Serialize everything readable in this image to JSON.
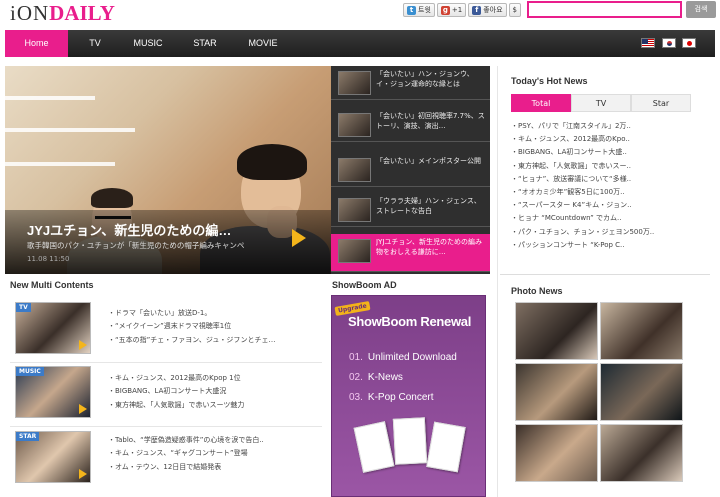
{
  "brand": {
    "ion": "iON",
    "daily": "DAILY"
  },
  "share": [
    {
      "label": "트윗",
      "icon": "twitter-icon",
      "color": "#3a8fd0"
    },
    {
      "label": "+1",
      "icon": "google-plus-icon",
      "color": "#d04232"
    },
    {
      "label": "좋아요",
      "icon": "facebook-icon",
      "color": "#3b5998"
    },
    {
      "label": "$",
      "icon": "dollar-icon",
      "color": "#777777"
    }
  ],
  "search": {
    "button": "검색",
    "placeholder": ""
  },
  "nav": {
    "home": "Home",
    "tv": "TV",
    "music": "MUSIC",
    "star": "STAR",
    "movie": "MOVIE"
  },
  "hero": {
    "title": "JYJユチョン、新生児のための編…",
    "desc": "歌手韓国のパク・ユチョンが「新生児のための帽子編みキャンペ",
    "date": "11.08 11:50"
  },
  "side_list": [
    "「会いたい」ハン・ジョンウ、イ・ジョン運命的な縁とは",
    "「会いたい」初回視聴率7.7%、ストーリ、演技、演出…",
    "「会いたい」メインポスター公開",
    "「ウララ夫婦」ハン・ジェンス、ストレートな告白",
    "JYJユチョン、新生児のための編み物をおしえる謙訪に…"
  ],
  "hot_news": {
    "title": "Today's Hot News",
    "tabs": [
      "Total",
      "TV",
      "Star"
    ],
    "items": [
      "・PSY、パリで「江南スタイル」2万..",
      "・キム・ジュンス、2012最高のKpo..",
      "・BIGBANG、LA初コンサート大盛..",
      "・東方神起、「人気歌謡」で赤いスー..",
      "・“ヒョナ”、放送審議について“多様..",
      "・“オオカミ少年”観客5日に100万..",
      "・“スーパースター K4”キム・ジョン..",
      "・ヒョナ “MCountdown” でカム..",
      "・パク・ユチョン、チョン・ジェヨン500万..",
      "・パッションコンサート “K-Pop C.."
    ]
  },
  "photo_news": {
    "title": "Photo News"
  },
  "multi": {
    "title": "New Multi Contents",
    "blocks": [
      {
        "tag": "TV",
        "lines": [
          "・ドラマ「会いたい」放送D-1。",
          "・“メイクイーン”週末ドラマ視聴率1位",
          "・“五本の指”チェ・ファヨン、ジュ・ジフンとチェ…"
        ]
      },
      {
        "tag": "MUSIC",
        "lines": [
          "・キム・ジュンス、2012最高のKpop 1位",
          "・BIGBANG、LA初コンサート大盛況",
          "・東方神起、「人気歌謡」で赤いスーツ魅力"
        ]
      },
      {
        "tag": "STAR",
        "lines": [
          "・Tablo、“学歴偽造疑惑事件”の心境を涙で告白..",
          "・キム・ジュンス、“ギャグコンサート”登場",
          "・オム・テウン、12日目で結婚発表"
        ]
      }
    ]
  },
  "ad": {
    "title": "ShowBoom AD",
    "badge": "Upgrade",
    "headline": "ShowBoom Renewal",
    "items": [
      {
        "num": "01.",
        "label": "Unlimited Download"
      },
      {
        "num": "02.",
        "label": "K-News"
      },
      {
        "num": "03.",
        "label": "K-Pop Concert"
      }
    ]
  },
  "colors": {
    "accent": "#e91e8c",
    "nav_bg": "#2a2a2a",
    "ad_purple": "#8a4796",
    "play_yellow": "#f4b51b"
  }
}
